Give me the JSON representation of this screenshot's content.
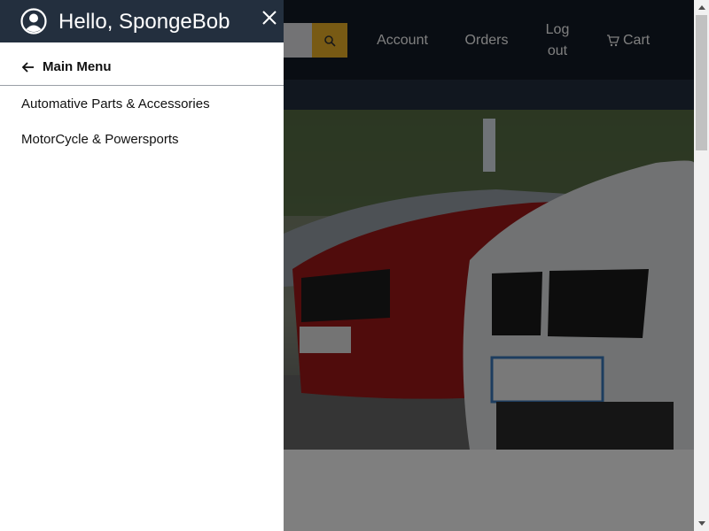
{
  "header": {
    "account_label": "Account",
    "orders_label": "Orders",
    "logout_label_line1": "Log",
    "logout_label_line2": "out",
    "cart_label": "Cart"
  },
  "side_menu": {
    "greeting": "Hello, SpongeBob",
    "back_label": "Main Menu",
    "items": [
      {
        "label": "Automative Parts & Accessories"
      },
      {
        "label": "MotorCycle & Powersports"
      }
    ]
  },
  "icons": {
    "avatar": "user-circle-icon",
    "close": "close-icon",
    "back": "arrow-left-icon",
    "search": "search-icon",
    "cart": "cart-icon"
  },
  "colors": {
    "header_bg": "#131a26",
    "menu_header_bg": "#232f3e",
    "search_button": "#f0b429"
  }
}
